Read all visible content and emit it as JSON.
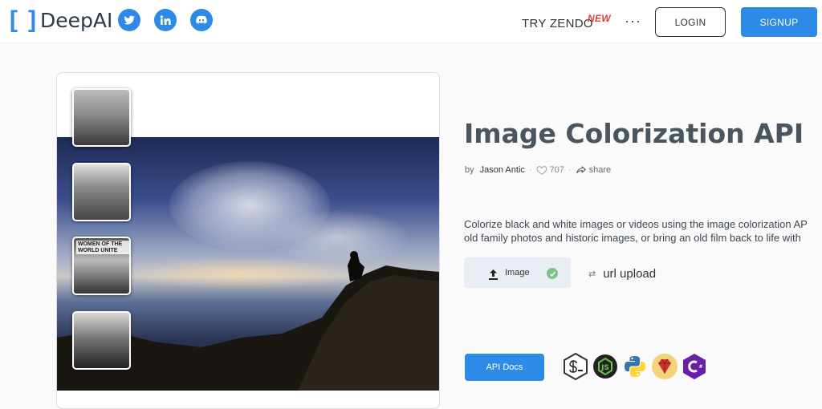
{
  "header": {
    "logo_text": "DeepAI",
    "social": [
      {
        "name": "twitter-icon"
      },
      {
        "name": "linkedin-icon"
      },
      {
        "name": "discord-icon"
      }
    ],
    "nav_zendo": "TRY ZENDO",
    "nav_zendo_badge": "NEW",
    "more": "···",
    "login": "LOGIN",
    "signup": "SIGNUP"
  },
  "gallery": {
    "thumb_caption_3": "WOMEN OF THE WORLD UNITE"
  },
  "api": {
    "title": "Image Colorization API",
    "by": "by",
    "author": "Jason Antic",
    "likes": "707",
    "share": "share",
    "description_1": "Colorize black and white images or videos using the image colorization AP",
    "description_2": "old family photos and historic images, or bring an old film back to life with"
  },
  "uploader": {
    "image_label": "Image",
    "url_label": "url upload"
  },
  "docs": {
    "api_docs_label": "API Docs",
    "languages": [
      "shell-icon",
      "nodejs-icon",
      "python-icon",
      "ruby-icon",
      "csharp-icon"
    ]
  },
  "colors": {
    "accent": "#2d8ae6",
    "new_badge": "#e23b3b"
  }
}
